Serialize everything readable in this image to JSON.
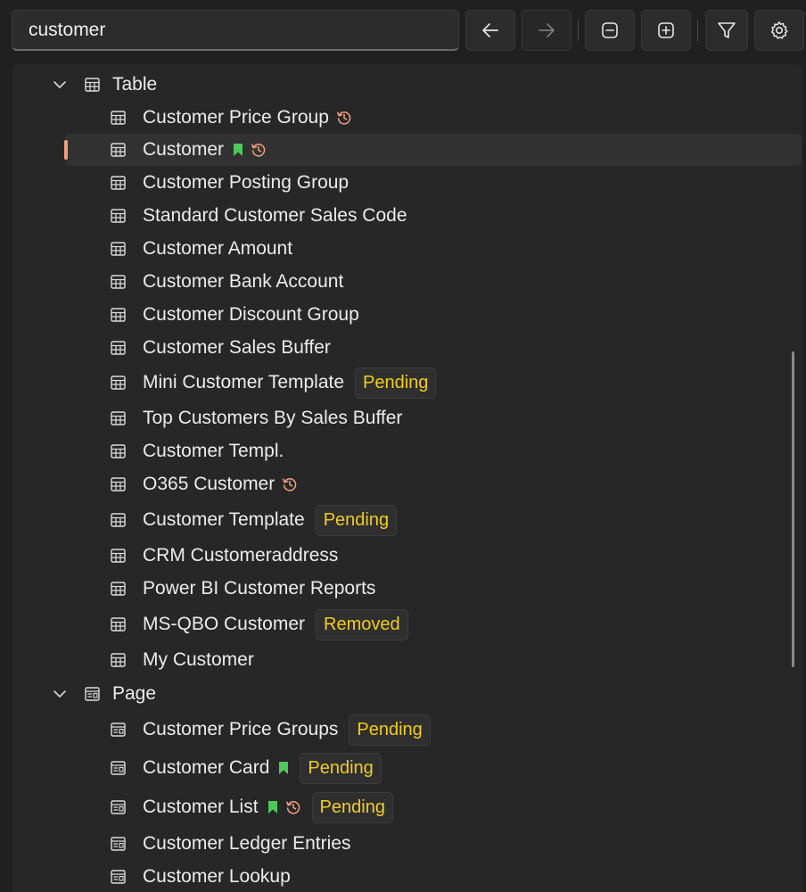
{
  "search": {
    "value": "customer",
    "placeholder": ""
  },
  "toolbar": {
    "back": "arrow-left-icon",
    "forward": "arrow-right-icon",
    "collapse": "minus-box-icon",
    "expand": "plus-box-icon",
    "filter": "filter-icon",
    "settings": "gear-icon"
  },
  "colors": {
    "badge": "#f2cc1e",
    "bookmark": "#4cc95a",
    "history": "#f0a080",
    "selection_bar": "#f0a080"
  },
  "tree": {
    "table_group": {
      "label": "Table"
    },
    "table_items": [
      {
        "label": "Customer Price Group",
        "bookmark": false,
        "history": true,
        "badge": ""
      },
      {
        "label": "Customer",
        "bookmark": true,
        "history": true,
        "badge": "",
        "selected": true
      },
      {
        "label": "Customer Posting Group",
        "bookmark": false,
        "history": false,
        "badge": ""
      },
      {
        "label": "Standard Customer Sales Code",
        "bookmark": false,
        "history": false,
        "badge": ""
      },
      {
        "label": "Customer Amount",
        "bookmark": false,
        "history": false,
        "badge": ""
      },
      {
        "label": "Customer Bank Account",
        "bookmark": false,
        "history": false,
        "badge": ""
      },
      {
        "label": "Customer Discount Group",
        "bookmark": false,
        "history": false,
        "badge": ""
      },
      {
        "label": "Customer Sales Buffer",
        "bookmark": false,
        "history": false,
        "badge": ""
      },
      {
        "label": "Mini Customer Template",
        "bookmark": false,
        "history": false,
        "badge": "Pending"
      },
      {
        "label": "Top Customers By Sales Buffer",
        "bookmark": false,
        "history": false,
        "badge": ""
      },
      {
        "label": "Customer Templ.",
        "bookmark": false,
        "history": false,
        "badge": ""
      },
      {
        "label": "O365 Customer",
        "bookmark": false,
        "history": true,
        "badge": ""
      },
      {
        "label": "Customer Template",
        "bookmark": false,
        "history": false,
        "badge": "Pending"
      },
      {
        "label": "CRM Customeraddress",
        "bookmark": false,
        "history": false,
        "badge": ""
      },
      {
        "label": "Power BI Customer Reports",
        "bookmark": false,
        "history": false,
        "badge": ""
      },
      {
        "label": "MS-QBO Customer",
        "bookmark": false,
        "history": false,
        "badge": "Removed"
      },
      {
        "label": "My Customer",
        "bookmark": false,
        "history": false,
        "badge": ""
      }
    ],
    "page_group": {
      "label": "Page"
    },
    "page_items": [
      {
        "label": "Customer Price Groups",
        "bookmark": false,
        "history": false,
        "badge": "Pending"
      },
      {
        "label": "Customer Card",
        "bookmark": true,
        "history": false,
        "badge": "Pending"
      },
      {
        "label": "Customer List",
        "bookmark": true,
        "history": true,
        "badge": "Pending"
      },
      {
        "label": "Customer Ledger Entries",
        "bookmark": false,
        "history": false,
        "badge": ""
      },
      {
        "label": "Customer Lookup",
        "bookmark": false,
        "history": false,
        "badge": ""
      }
    ]
  }
}
